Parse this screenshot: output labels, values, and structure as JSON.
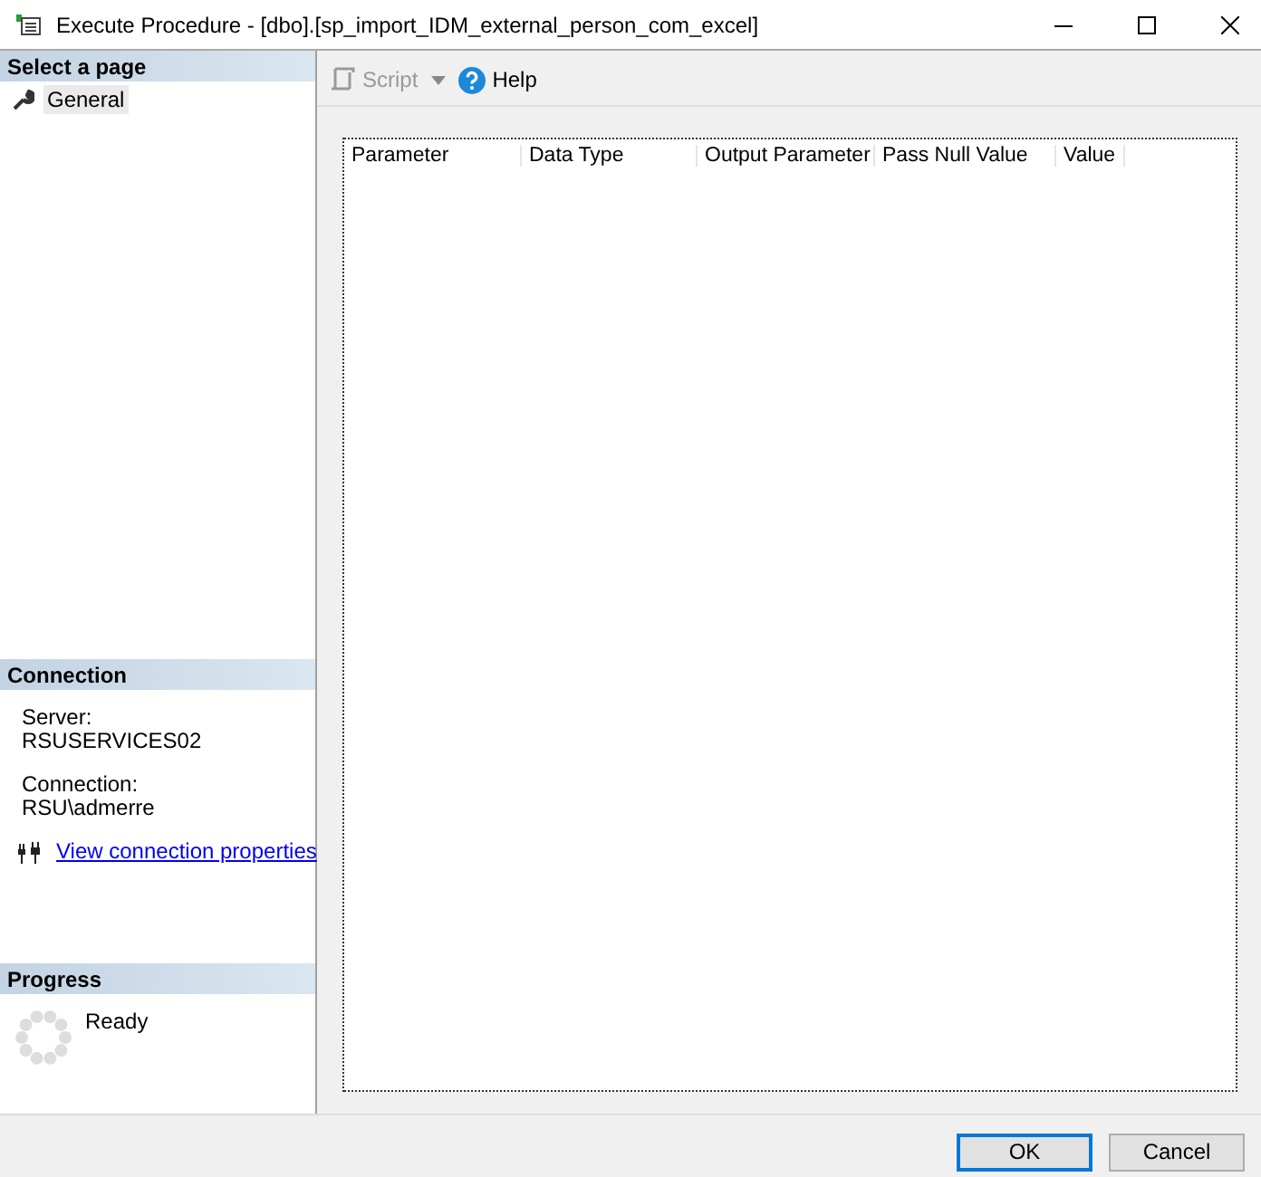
{
  "window": {
    "title": "Execute Procedure - [dbo].[sp_import_IDM_external_person_com_excel]"
  },
  "sidebar": {
    "header": "Select a page",
    "items": [
      {
        "label": "General",
        "selected": true
      }
    ]
  },
  "toolbar": {
    "script": {
      "label": "Script",
      "disabled": true
    },
    "help": {
      "label": "Help"
    }
  },
  "table": {
    "columns": [
      "Parameter",
      "Data Type",
      "Output Parameter",
      "Pass Null Value",
      "Value"
    ]
  },
  "connection": {
    "header": "Connection",
    "server_label": "Server:",
    "server": "RSUSERVICES02",
    "connection_label": "Connection:",
    "connection": "RSU\\admerre",
    "link": "View connection properties"
  },
  "progress": {
    "header": "Progress",
    "status": "Ready"
  },
  "buttons": [
    {
      "label": "OK",
      "default": true
    },
    {
      "label": "Cancel",
      "default": false
    }
  ]
}
